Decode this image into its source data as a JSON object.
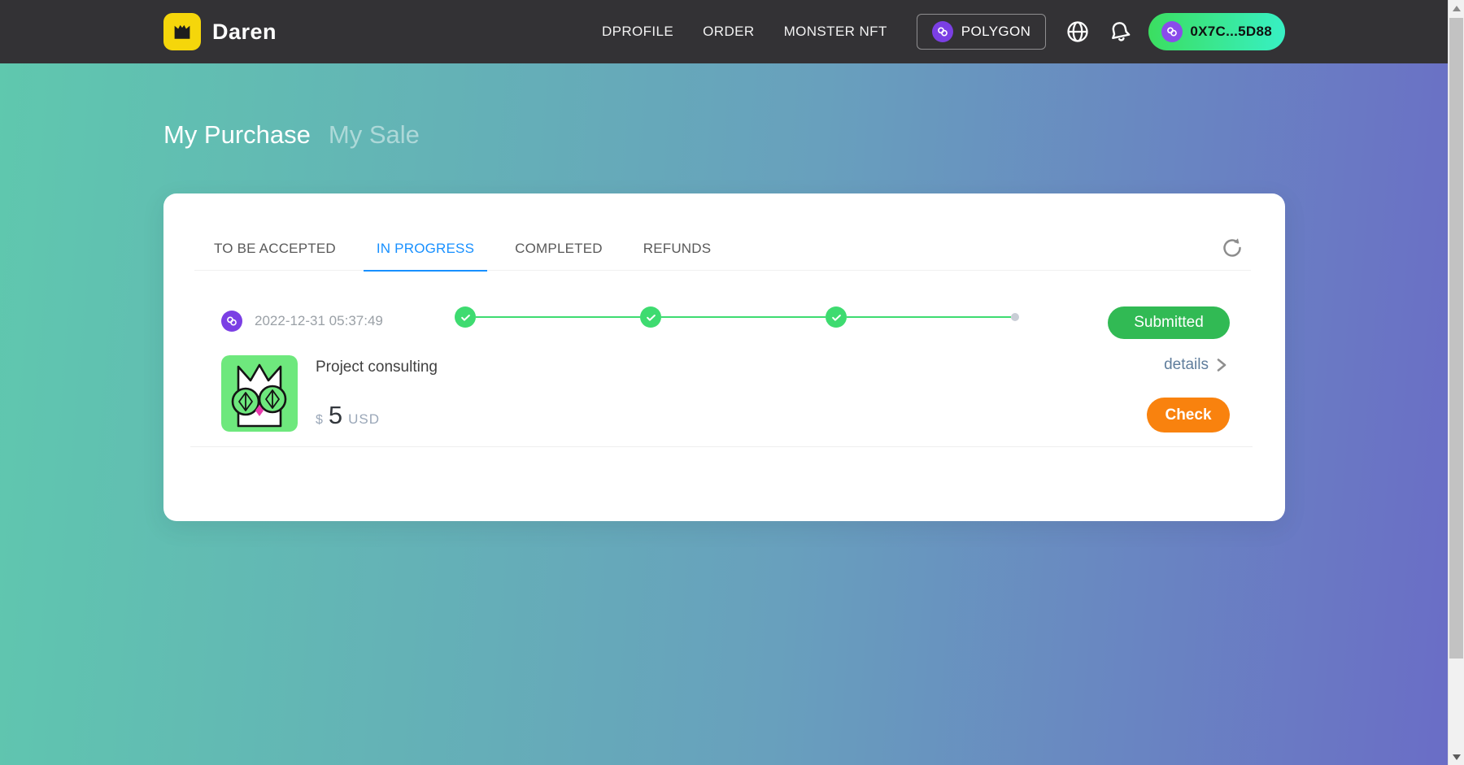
{
  "navbar": {
    "brand": "Daren",
    "links": [
      {
        "label": "DPROFILE"
      },
      {
        "label": "ORDER"
      },
      {
        "label": "MONSTER NFT"
      }
    ],
    "network_button": {
      "label": "POLYGON"
    },
    "wallet_button": {
      "address": "0X7C...5D88"
    },
    "icons": [
      "crown-icon",
      "polygon-icon",
      "globe-icon",
      "notification-icon"
    ]
  },
  "hero": {
    "tabs": [
      {
        "label": "My Purchase",
        "active": true
      },
      {
        "label": "My Sale",
        "active": false
      }
    ]
  },
  "card": {
    "tabs": [
      {
        "label": "TO BE ACCEPTED",
        "active": false
      },
      {
        "label": "IN PROGRESS",
        "active": true
      },
      {
        "label": "COMPLETED",
        "active": false
      },
      {
        "label": "REFUNDS",
        "active": false
      }
    ],
    "order": {
      "timestamp": "2022-12-31 05:37:49",
      "status_label": "Submitted",
      "steps": {
        "completed": 3,
        "total": 4
      },
      "product": {
        "title": "Project consulting",
        "currency_symbol": "$",
        "price": "5",
        "currency_code": "USD",
        "details_label": "details",
        "check_label": "Check"
      }
    }
  },
  "colors": {
    "navbar_bg": "#333235",
    "brand_yellow": "#f5d60b",
    "bg_gradient_left": "#5fc8ae",
    "bg_gradient_right": "#6a6dc6",
    "active_tab_blue": "#1890ff",
    "stepper_green": "#3edb70",
    "pending_dot_gray": "#c9ced6",
    "submitted_green": "#31ba54",
    "check_orange": "#f9820e",
    "polygon_purple": "#7b3fe4",
    "wallet_gradient_left": "#3bde60",
    "wallet_gradient_right": "#38f0c4",
    "nft_bg_green": "#6ee87d"
  }
}
